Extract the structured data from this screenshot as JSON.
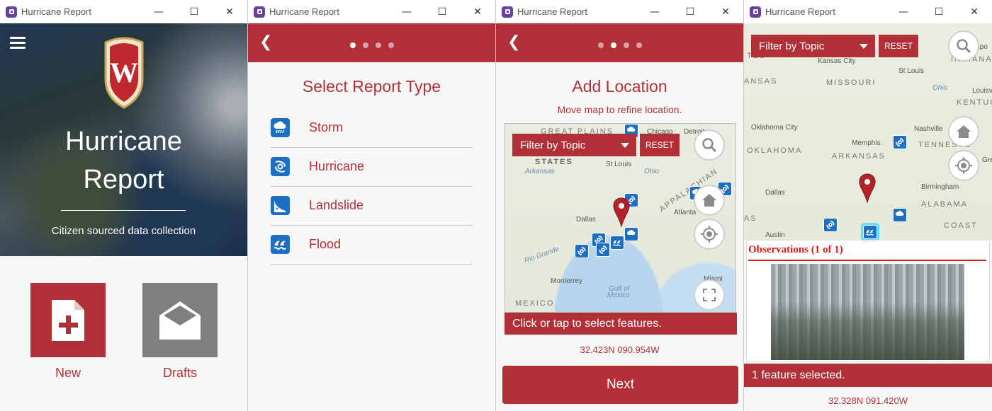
{
  "app_title": "Hurricane Report",
  "window_controls": {
    "minimize": "—",
    "maximize": "☐",
    "close": "✕"
  },
  "home": {
    "title_line1": "Hurricane",
    "title_line2": "Report",
    "subtitle": "Citizen sourced data collection",
    "new_label": "New",
    "drafts_label": "Drafts"
  },
  "report_type": {
    "heading": "Select Report Type",
    "items": [
      {
        "label": "Storm",
        "icon": "storm-icon"
      },
      {
        "label": "Hurricane",
        "icon": "hurricane-icon"
      },
      {
        "label": "Landslide",
        "icon": "landslide-icon"
      },
      {
        "label": "Flood",
        "icon": "flood-icon"
      }
    ]
  },
  "add_location": {
    "heading": "Add Location",
    "subheading": "Move map to refine location.",
    "filter_label": "Filter by Topic",
    "reset_label": "RESET",
    "status": "Click or tap to select features.",
    "coordinates": "32.423N 090.954W",
    "next_label": "Next",
    "map_labels": {
      "great_plains": "GREAT PLAINS",
      "chicago": "Chicago",
      "detroit": "Detroit",
      "states": "STATES",
      "st_louis": "St Louis",
      "arkansas_river": "Arkansas",
      "ohio": "Ohio",
      "appalachian": "APPALACHIAN",
      "atlanta": "Atlanta",
      "dallas": "Dallas",
      "rio_grande": "Rio Grande",
      "monterrey": "Monterrey",
      "gulf": "Gulf of",
      "mexico_water": "Mexico",
      "mexico": "MEXICO",
      "miami": "Miami"
    }
  },
  "results": {
    "filter_label": "Filter by Topic",
    "reset_label": "RESET",
    "popup_title": "Observations (1 of 1)",
    "status": "1 feature selected.",
    "coordinates": "32.328N 091.420W",
    "map_labels": {
      "indianapolis": "Indianapo",
      "kansas_city": "Kansas City",
      "st_louis": "St Louis",
      "indiana": "INDIANA",
      "tes": "TES",
      "ansas": "ANSAS",
      "missouri": "MISSOURI",
      "ohio": "Ohio",
      "louisville": "Louisvi",
      "kentucky": "KENTUCKY",
      "oklahoma_city": "Oklahoma City",
      "oklahoma": "OKLAHOMA",
      "nashville": "Nashville",
      "memphis": "Memphis",
      "tennessee": "TENNESSE",
      "arkansas": "ARKANSAS",
      "gre": "Gre",
      "dallas": "Dallas",
      "birmingham": "Birmingham",
      "alabama": "ALABAMA",
      "as": "AS",
      "austin": "Austin",
      "coast": "COAST"
    }
  }
}
